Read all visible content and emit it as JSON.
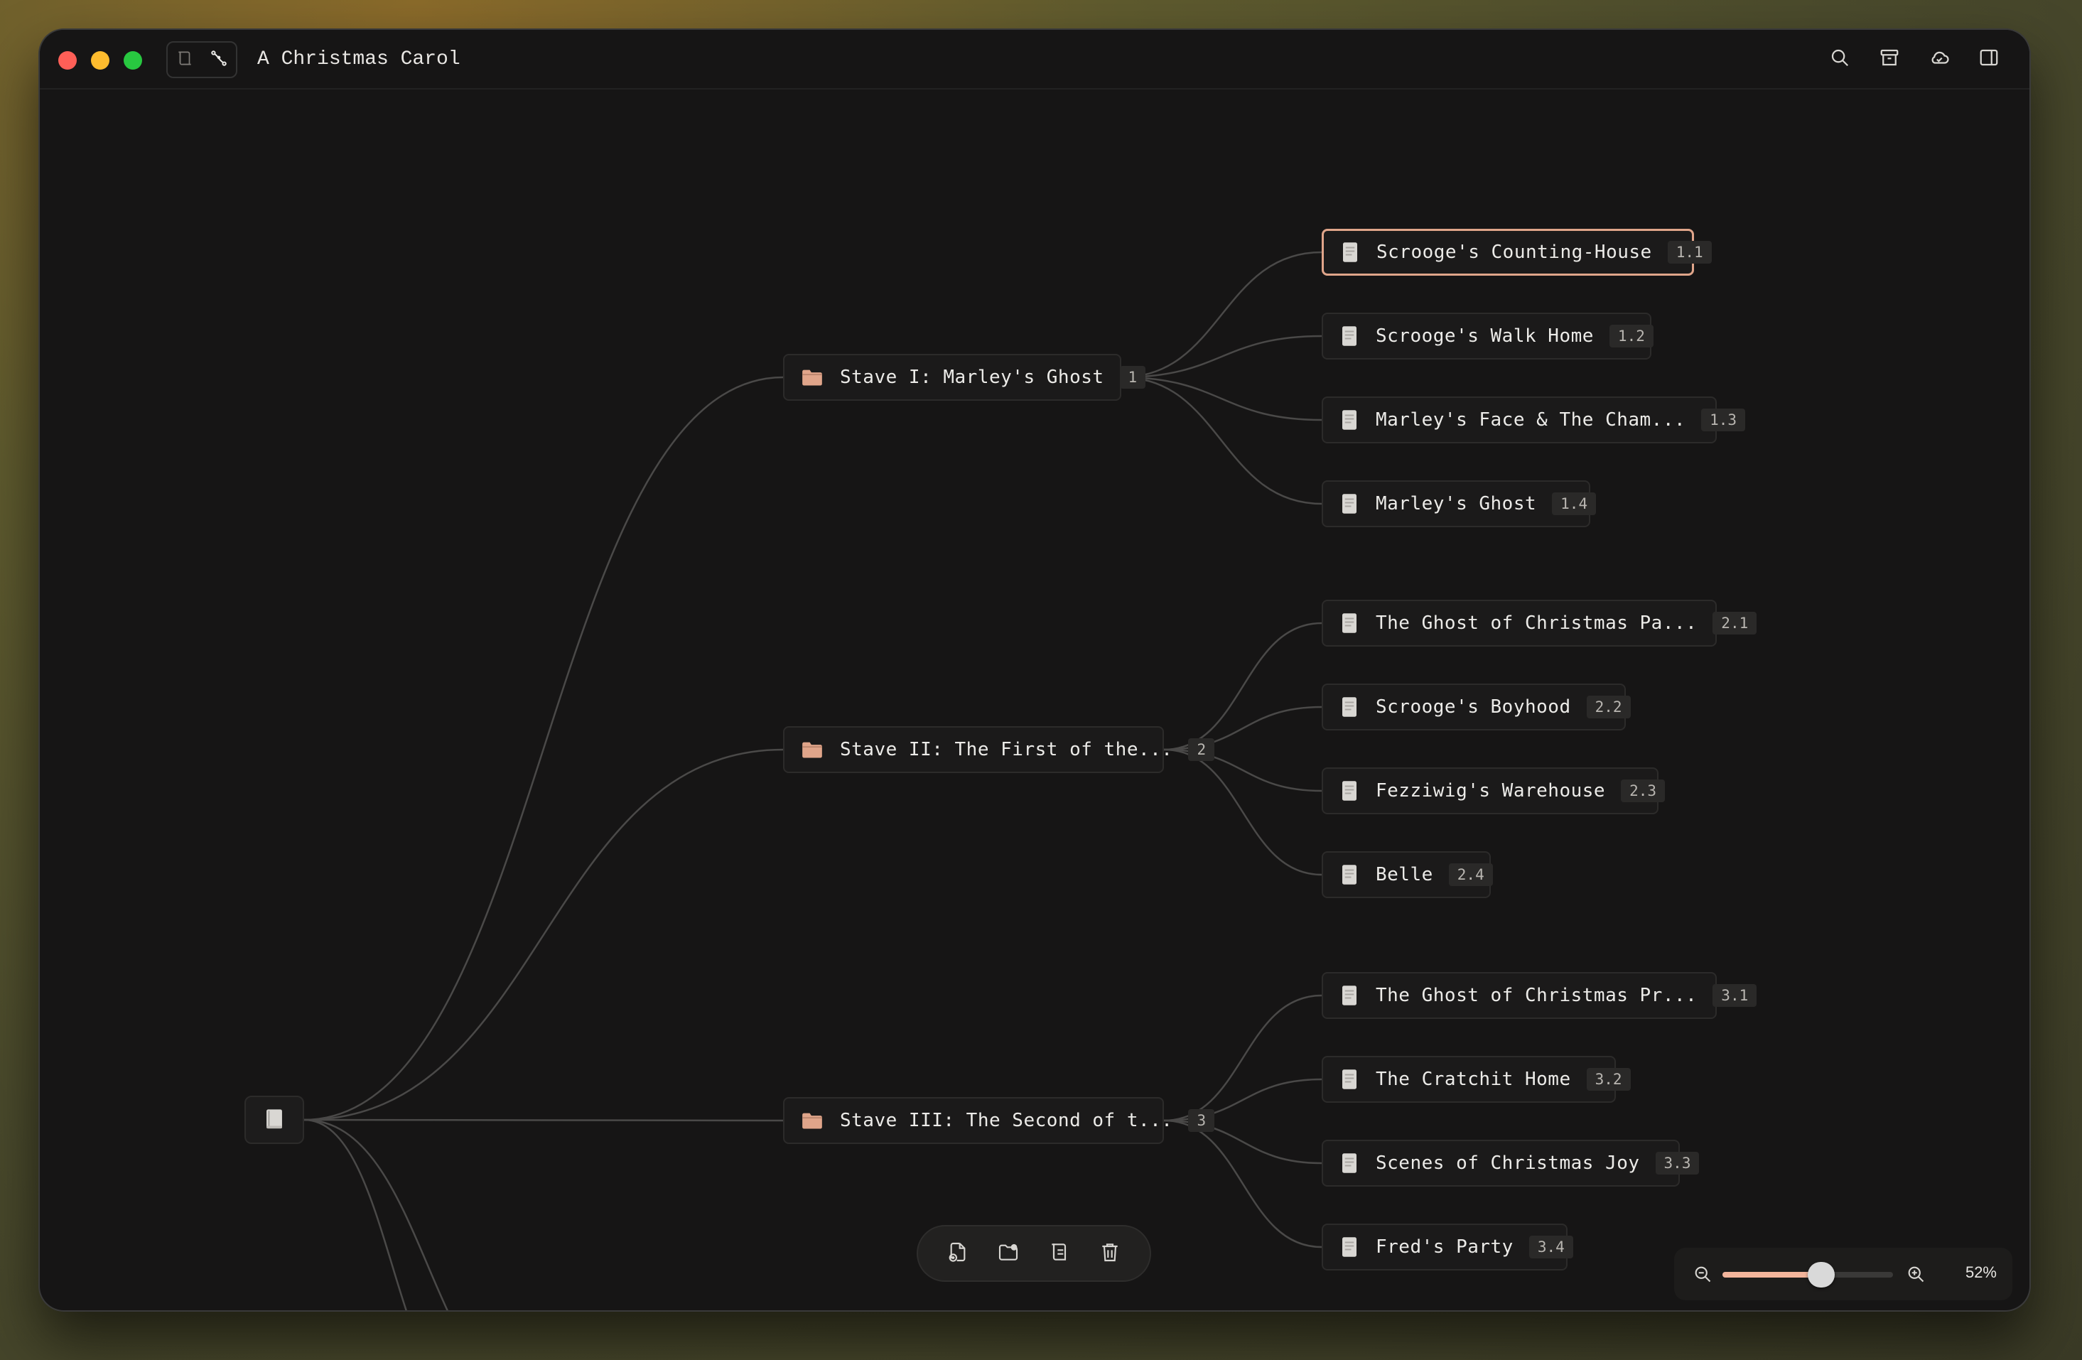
{
  "window": {
    "title": "A Christmas Carol"
  },
  "toolbar": {
    "view_toggle": [
      "outline-icon",
      "mindmap-icon"
    ],
    "right_icons": [
      "search-icon",
      "archive-icon",
      "cloud-sync-icon",
      "sidebar-toggle-icon"
    ]
  },
  "root": {
    "icon": "book-icon"
  },
  "staves": [
    {
      "label": "Stave I: Marley's Ghost",
      "badge": "1",
      "icon": "folder-icon",
      "children": [
        {
          "label": "Scrooge's Counting-House",
          "badge": "1.1",
          "selected": true
        },
        {
          "label": "Scrooge's Walk Home",
          "badge": "1.2"
        },
        {
          "label": "Marley's Face & The Cham...",
          "badge": "1.3"
        },
        {
          "label": "Marley's Ghost",
          "badge": "1.4"
        }
      ]
    },
    {
      "label": "Stave II: The First of the...",
      "badge": "2",
      "icon": "folder-icon",
      "children": [
        {
          "label": "The Ghost of Christmas Pa...",
          "badge": "2.1"
        },
        {
          "label": "Scrooge's Boyhood",
          "badge": "2.2"
        },
        {
          "label": "Fezziwig's Warehouse",
          "badge": "2.3"
        },
        {
          "label": "Belle",
          "badge": "2.4"
        }
      ]
    },
    {
      "label": "Stave III: The Second of t...",
      "badge": "3",
      "icon": "folder-icon",
      "children": [
        {
          "label": "The Ghost of Christmas Pr...",
          "badge": "3.1"
        },
        {
          "label": "The Cratchit Home",
          "badge": "3.2"
        },
        {
          "label": "Scenes of Christmas Joy",
          "badge": "3.3"
        },
        {
          "label": "Fred's Party",
          "badge": "3.4"
        }
      ]
    }
  ],
  "bottom_toolbar": [
    "new-document-icon",
    "new-folder-icon",
    "move-icon",
    "trash-icon"
  ],
  "zoom": {
    "percent_label": "52%",
    "level": 0.52
  },
  "colors": {
    "accent": "#f3b59c",
    "folder": "#e0a58a",
    "edge": "#4a4948",
    "selected_border": "#e0a58a"
  }
}
